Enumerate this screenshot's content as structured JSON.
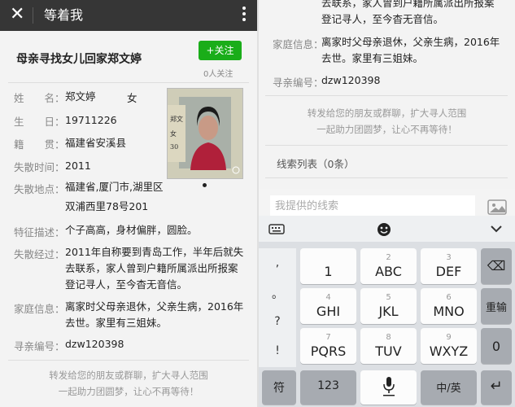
{
  "left": {
    "app_bar": {
      "close": "✕",
      "title": "等着我"
    },
    "header": {
      "title": "母亲寻找女儿回家郑文婷",
      "follow_label": "+关注",
      "follow_count": "0人关注"
    },
    "fields": {
      "name": {
        "label": "姓　　名：",
        "value": "郑文婷",
        "gender": "女"
      },
      "birth": {
        "label": "生　　日：",
        "value": "19711226"
      },
      "origin": {
        "label": "籍　　贯：",
        "value": "福建省安溪县"
      },
      "lost_time": {
        "label": "失散时间：",
        "value": "2011"
      },
      "lost_place": {
        "label": "失散地点：",
        "line1": "福建省,厦门市,湖里区",
        "line2": "双浦西里78号201"
      },
      "features": {
        "label": "特征描述：",
        "value": "个子高高，身材偏胖，圆脸。"
      },
      "story": {
        "label": "失散经过：",
        "line1": "2011年自称要到青岛工作，半年后就失",
        "line2": "去联系，家人曾到户籍所属派出所报案",
        "line3": "登记寻人，至今杳无音信。"
      },
      "family": {
        "label": "家庭信息：",
        "line1": "离家时父母亲退休，父亲生病，2016年",
        "line2": "去世。家里有三姐妹。"
      },
      "search_id": {
        "label": "寻亲编号：",
        "value": "dzw120398"
      }
    },
    "share": {
      "line1": "转发给您的朋友或群聊，扩大寻人范围",
      "line2": "一起助力团圆梦，让心不再等待！"
    }
  },
  "right": {
    "story_tail": {
      "line1": "去联系，家人曾到户籍所属派出所报案",
      "line2": "登记寻人，至今杳无音信。"
    },
    "family": {
      "label": "家庭信息：",
      "line1": "离家时父母亲退休，父亲生病，2016年",
      "line2": "去世。家里有三姐妹。"
    },
    "search_id": {
      "label": "寻亲编号：",
      "value": "dzw120398"
    },
    "share": {
      "line1": "转发给您的朋友或群聊，扩大寻人范围",
      "line2": "一起助力团圆梦，让心不再等待！"
    },
    "clue_list": "线索列表（0条）",
    "input_placeholder": "我提供的线索",
    "keyboard": {
      "symbols": [
        ",",
        "。",
        "?",
        "!"
      ],
      "keys": [
        {
          "digit": "",
          "letters": "1"
        },
        {
          "digit": "2",
          "letters": "ABC"
        },
        {
          "digit": "3",
          "letters": "DEF"
        },
        {
          "digit": "4",
          "letters": "GHI"
        },
        {
          "digit": "5",
          "letters": "JKL"
        },
        {
          "digit": "6",
          "letters": "MNO"
        },
        {
          "digit": "7",
          "letters": "PQRS"
        },
        {
          "digit": "8",
          "letters": "TUV"
        },
        {
          "digit": "9",
          "letters": "WXYZ"
        }
      ],
      "backspace": "⌫",
      "reenter": "重输",
      "zero": "0",
      "sym": "符",
      "num": "123",
      "lang": "中/英",
      "enter": "↵"
    }
  }
}
